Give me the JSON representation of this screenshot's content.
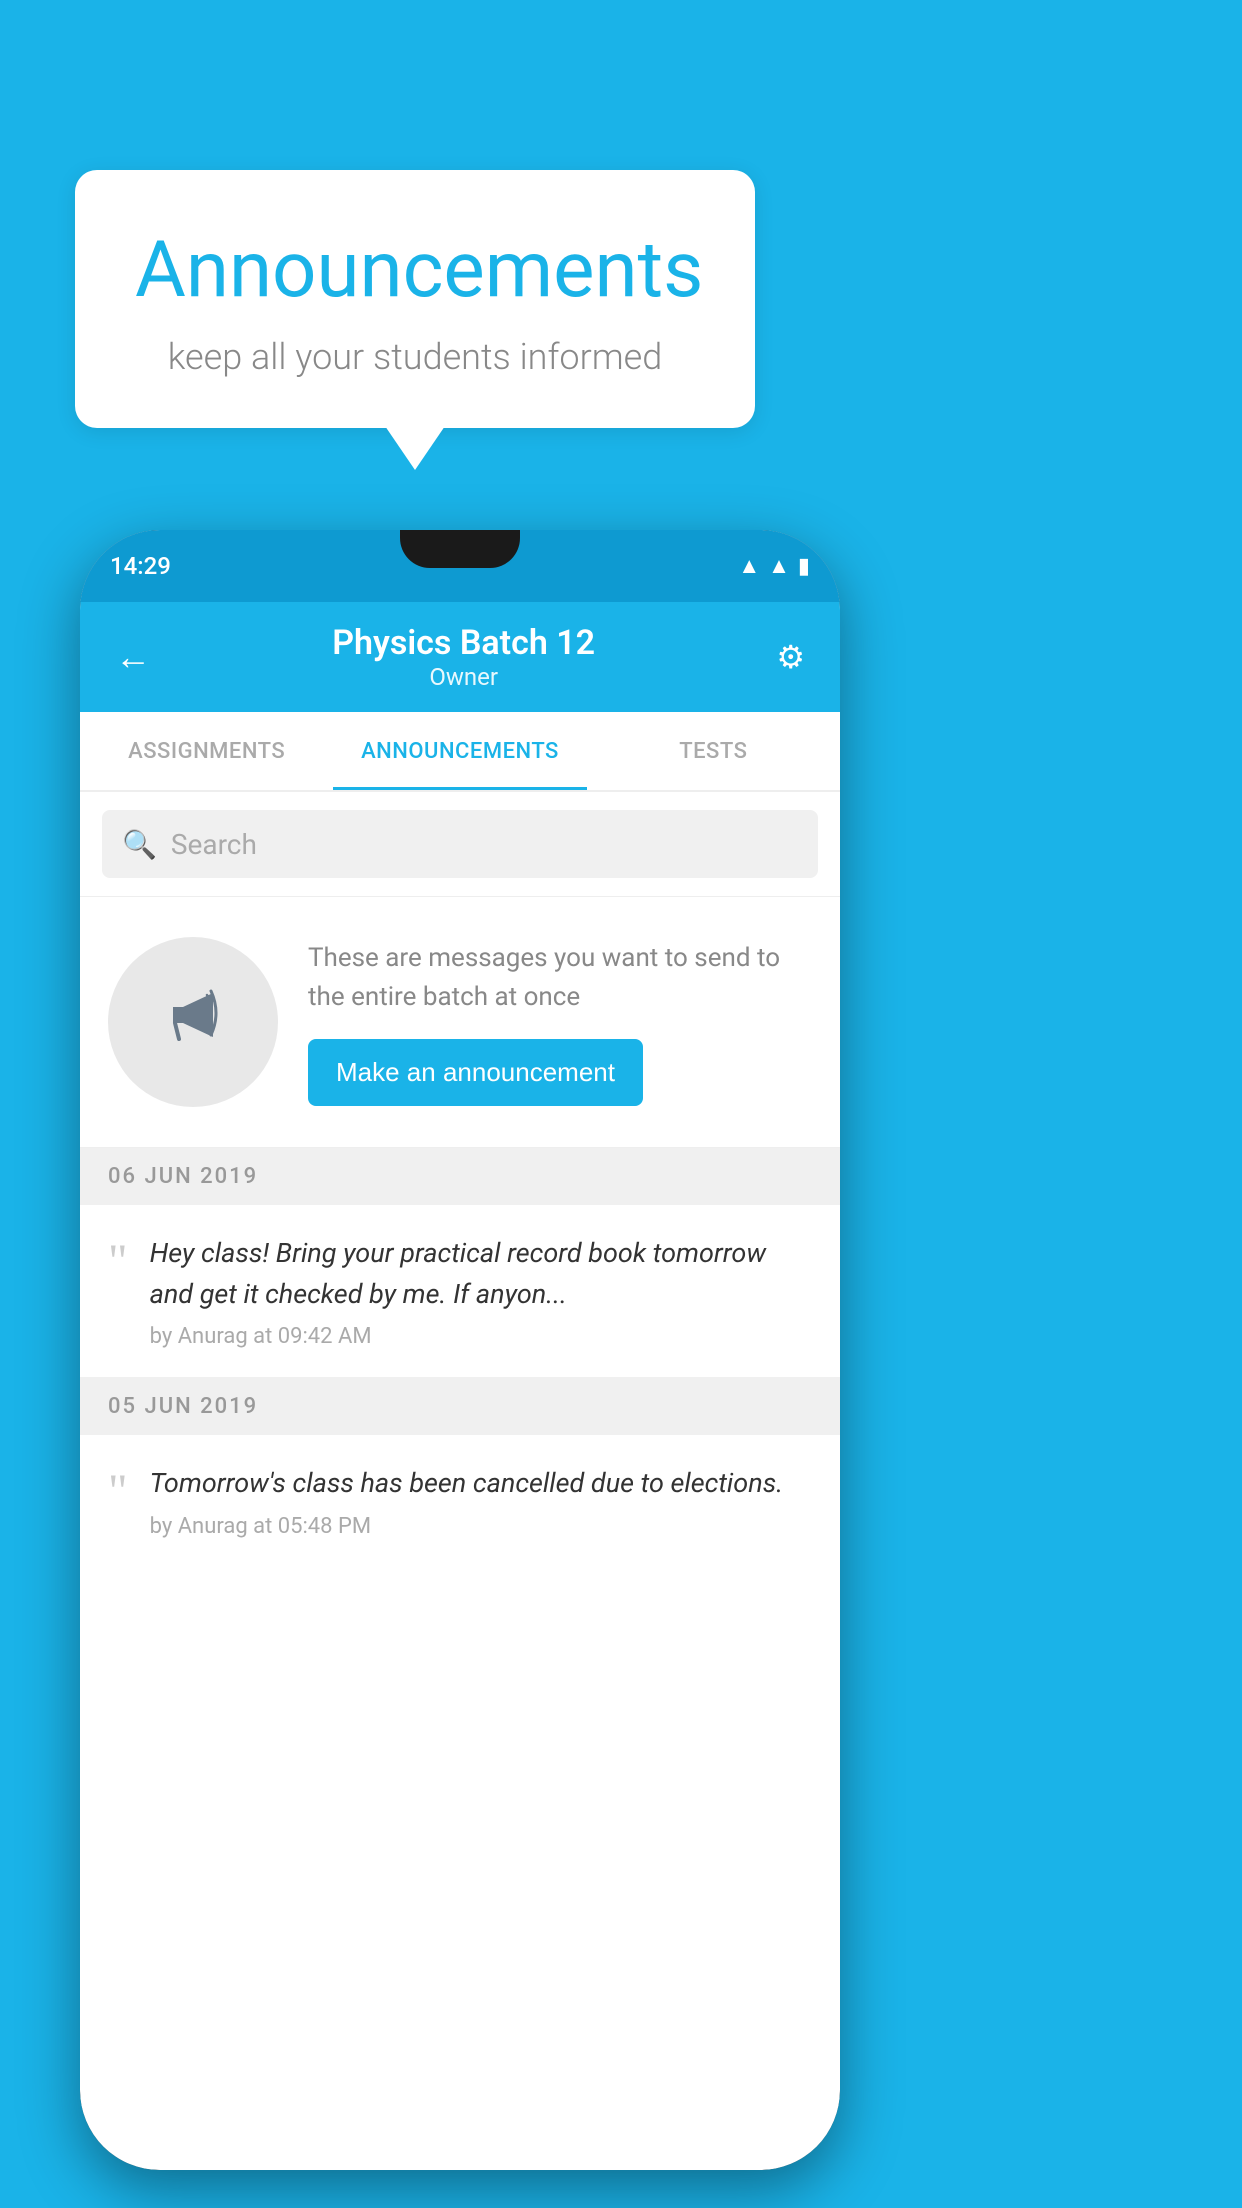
{
  "background_color": "#1ab3e8",
  "speech_bubble": {
    "title": "Announcements",
    "subtitle": "keep all your students informed"
  },
  "phone": {
    "status_bar": {
      "time": "14:29",
      "icons": [
        "wifi",
        "signal",
        "battery"
      ]
    },
    "app_bar": {
      "back_label": "←",
      "title": "Physics Batch 12",
      "subtitle": "Owner",
      "settings_label": "⚙"
    },
    "tabs": [
      {
        "label": "ASSIGNMENTS",
        "active": false
      },
      {
        "label": "ANNOUNCEMENTS",
        "active": true
      },
      {
        "label": "TESTS",
        "active": false
      }
    ],
    "search": {
      "placeholder": "Search"
    },
    "promo": {
      "icon": "📢",
      "text": "These are messages you want to send to the entire batch at once",
      "button_label": "Make an announcement"
    },
    "announcements": [
      {
        "date_separator": "06  JUN  2019",
        "text": "Hey class! Bring your practical record book tomorrow and get it checked by me. If anyon...",
        "meta": "by Anurag at 09:42 AM"
      },
      {
        "date_separator": "05  JUN  2019",
        "text": "Tomorrow's class has been cancelled due to elections.",
        "meta": "by Anurag at 05:48 PM"
      }
    ]
  }
}
